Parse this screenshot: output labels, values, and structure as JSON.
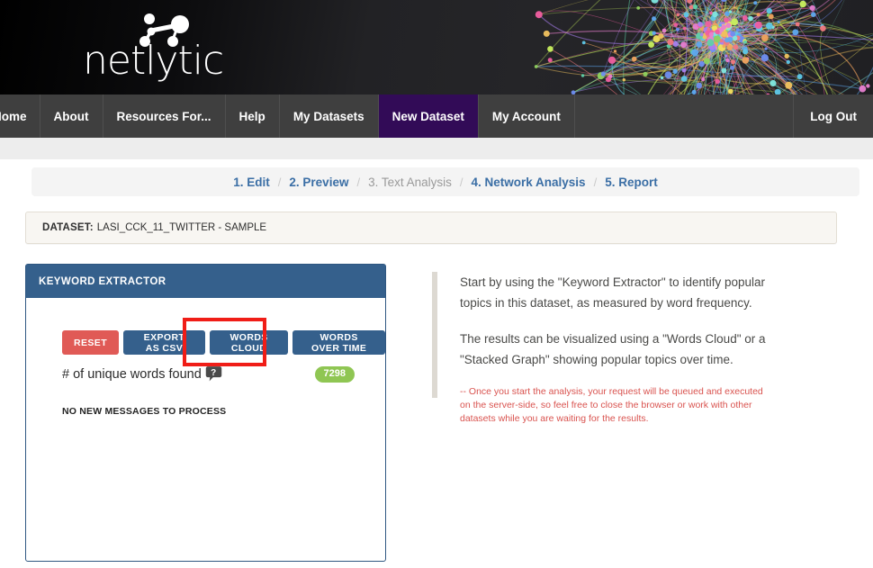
{
  "banner": {
    "logo_text": "netlytic",
    "logo_icon": "network-nodes-icon",
    "background_art": "network-graph-visualization"
  },
  "nav": {
    "items": [
      {
        "label": "Home",
        "active": false
      },
      {
        "label": "About",
        "active": false
      },
      {
        "label": "Resources For...",
        "active": false
      },
      {
        "label": "Help",
        "active": false
      },
      {
        "label": "My Datasets",
        "active": false
      },
      {
        "label": "New Dataset",
        "active": true
      },
      {
        "label": "My Account",
        "active": false
      }
    ],
    "right_item": {
      "label": "Log Out"
    },
    "active_color": "#320b57"
  },
  "steps": {
    "separator": "/",
    "items": [
      {
        "label": "1. Edit",
        "state": "link"
      },
      {
        "label": "2. Preview",
        "state": "link"
      },
      {
        "label": "3. Text Analysis",
        "state": "current"
      },
      {
        "label": "4. Network Analysis",
        "state": "link"
      },
      {
        "label": "5. Report",
        "state": "link"
      }
    ]
  },
  "dataset": {
    "label": "DATASET:",
    "value": "LASI_CCK_11_TWITTER - SAMPLE"
  },
  "panel": {
    "title": "KEYWORD EXTRACTOR",
    "buttons": [
      {
        "label": "RESET",
        "style": "danger",
        "name": "reset-button"
      },
      {
        "label": "EXPORT AS CSV",
        "style": "primary",
        "name": "export-as-csv-button"
      },
      {
        "label": "WORDS CLOUD",
        "style": "primary",
        "name": "words-cloud-button",
        "highlighted": true
      },
      {
        "label": "WORDS OVER TIME",
        "style": "primary",
        "name": "words-over-time-button"
      }
    ],
    "stat": {
      "label": "# of unique words found",
      "help_icon": "question-bubble-icon",
      "badge_value": "7298",
      "badge_color": "#8fc653"
    },
    "status_message": "NO NEW MESSAGES TO PROCESS"
  },
  "info": {
    "paragraph1": "Start by using the \"Keyword Extractor\" to identify popular topics in this dataset, as measured by word frequency.",
    "paragraph2": "The results can be visualized using a \"Words Cloud\" or a \"Stacked Graph\" showing popular topics over time.",
    "note": "-- Once you start the analysis, your request will be queued and executed on the server-side, so feel free to close the browser or work with other datasets while you are waiting for the results."
  },
  "colors": {
    "accent_blue": "#35608c",
    "danger_red": "#e05a56",
    "highlight_red": "#f01d17",
    "badge_green": "#8fc653",
    "nav_active_purple": "#320b57"
  }
}
